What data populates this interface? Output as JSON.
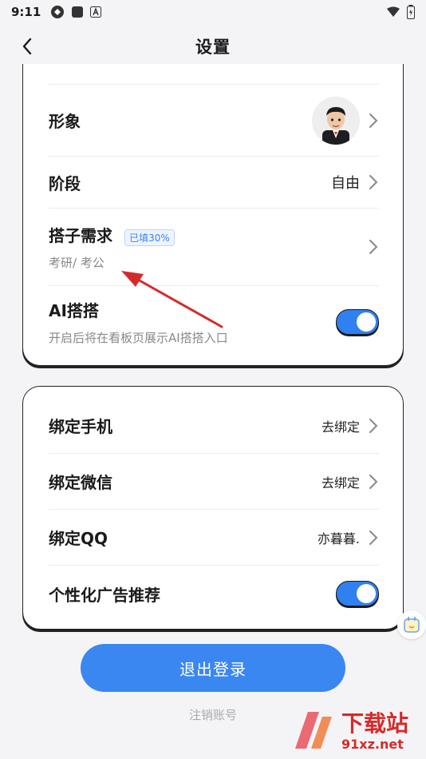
{
  "status": {
    "time": "9:11"
  },
  "nav": {
    "title": "设置"
  },
  "card1": {
    "avatar_label": "形象",
    "stage_label": "阶段",
    "stage_value": "自由",
    "partner_label": "搭子需求",
    "partner_badge": "已填30%",
    "partner_sub": "考研/ 考公",
    "ai_label": "AI搭搭",
    "ai_sub": "开启后将在看板页展示AI搭搭入口",
    "ai_enabled": true
  },
  "card2": {
    "bind_phone_label": "绑定手机",
    "bind_phone_value": "去绑定",
    "bind_wechat_label": "绑定微信",
    "bind_wechat_value": "去绑定",
    "bind_qq_label": "绑定QQ",
    "bind_qq_value": "亦暮暮.",
    "ad_label": "个性化广告推荐",
    "ad_enabled": true
  },
  "actions": {
    "logout": "退出登录",
    "cancel_account": "注销账号"
  },
  "watermark": {
    "text_big": "下载站",
    "text_small": "91xz.net"
  },
  "colors": {
    "accent": "#3a87f2",
    "toggle_on": "#2f80f0",
    "annotation": "#d62a2a"
  }
}
